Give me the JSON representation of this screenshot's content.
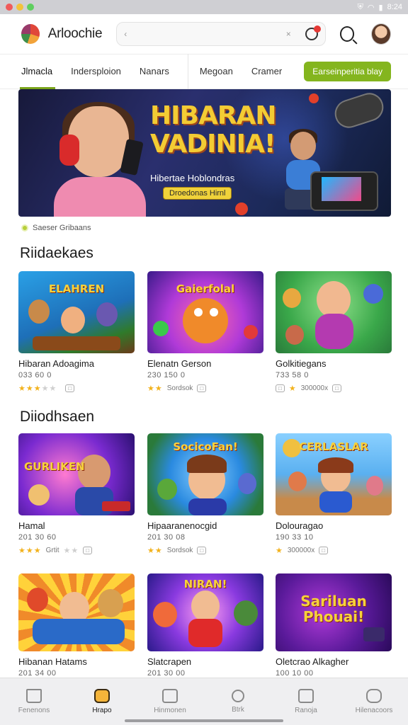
{
  "status_bar": {
    "time": "8:24",
    "dot_colors": [
      "#f05a5a",
      "#f2c23a",
      "#5fcf5f"
    ]
  },
  "header": {
    "app_name": "Arloochie",
    "search_placeholder": "",
    "search_hint": "‹",
    "search_hint_right": "×"
  },
  "tabs": [
    {
      "label": "Jlmacla"
    },
    {
      "label": "Indersploion"
    },
    {
      "label": "Nanars"
    },
    {
      "label": "Megoan"
    },
    {
      "label": "Cramer"
    }
  ],
  "cta_label": "Earseinperitia blay",
  "banner": {
    "title_line1": "HIBARAN",
    "title_line2": "VADINIA!",
    "subtitle": "Hibertae Hoblondras",
    "button_label": "Droedonas Hirnl"
  },
  "trending_label": "Saeser Gribaans",
  "sections": [
    {
      "title": "Riidaekaes",
      "cards": [
        {
          "name": "Hibaran Adoagima",
          "meta": "033 60 0",
          "rating_text": "",
          "stars": 3,
          "thumb_title": "ELAHREN"
        },
        {
          "name": "Elenatn Gerson",
          "meta": "230 150 0",
          "rating_text": "Sordsok",
          "stars": 2,
          "thumb_title": "Gaierfolal"
        },
        {
          "name": "Golkitiegans",
          "meta": "733 58 0",
          "rating_text": "300000x",
          "stars": 1,
          "thumb_title": ""
        }
      ]
    },
    {
      "title": "Diiodhsaen",
      "cards": [
        {
          "name": "Hamal",
          "meta": "201 30 60",
          "rating_text": "Grtit",
          "stars": 3,
          "thumb_title": "GURLIKEN"
        },
        {
          "name": "Hipaaranenocgid",
          "meta": "201 30 08",
          "rating_text": "Sordsok",
          "stars": 2,
          "thumb_title": "SocicoFan!"
        },
        {
          "name": "Dolouragao",
          "meta": "190 33 10",
          "rating_text": "300000x",
          "stars": 1,
          "thumb_title": "CERLASLAR"
        }
      ]
    },
    {
      "title": "",
      "cards": [
        {
          "name": "Hibanan Hatams",
          "meta": "201 34 00",
          "thumb_title": ""
        },
        {
          "name": "Slatcrapen",
          "meta": "201 30 00",
          "thumb_title": "NIRAN!"
        },
        {
          "name": "Oletcrao Alkagher",
          "meta": "100 10 00",
          "thumb_title": "Sariluan Phouai!"
        }
      ]
    }
  ],
  "bottom_nav": [
    {
      "label": "Fenenons",
      "icon": "home-icon"
    },
    {
      "label": "Hrapo",
      "icon": "game-icon"
    },
    {
      "label": "Hinmonen",
      "icon": "gallery-icon"
    },
    {
      "label": "Btrk",
      "icon": "search-icon"
    },
    {
      "label": "Ranoja",
      "icon": "wallet-icon"
    },
    {
      "label": "Hilenacoors",
      "icon": "messages-icon"
    }
  ]
}
